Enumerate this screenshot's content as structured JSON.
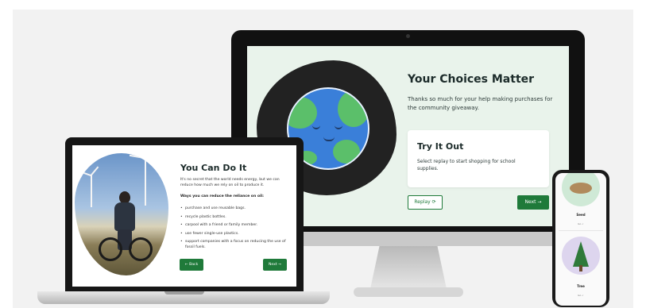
{
  "desktop": {
    "title": "Your Choices Matter",
    "text": "Thanks so much for your help making purchases for the community giveaway.",
    "card": {
      "title": "Try It Out",
      "text": "Select replay to start shopping for school supplies."
    },
    "replay_label": "Replay ⟳",
    "next_label": "Next →"
  },
  "laptop": {
    "title": "You Can Do It",
    "intro": "It's no secret that the world needs energy, but we can reduce how much we rely on oil to produce it.",
    "subtitle": "Ways you can reduce the reliance on oil:",
    "items": [
      "purchase and use reusable bags.",
      "recycle plastic bottles.",
      "carpool with a friend or family member.",
      "use fewer single-use plastics.",
      "support companies with a focus on reducing the use of fossil fuels."
    ],
    "back_label": "← Back",
    "next_label": "Next →"
  },
  "phone": {
    "items": [
      {
        "label": "Seed",
        "sub": "Go ✓"
      },
      {
        "label": "Tree",
        "sub": "Go ✓"
      }
    ]
  },
  "colors": {
    "accent": "#1f7a3a",
    "desktop_bg": "#e9f3eb",
    "phone_seed_bg": "#cfe9d6",
    "phone_tree_bg": "#ddd5ee"
  }
}
